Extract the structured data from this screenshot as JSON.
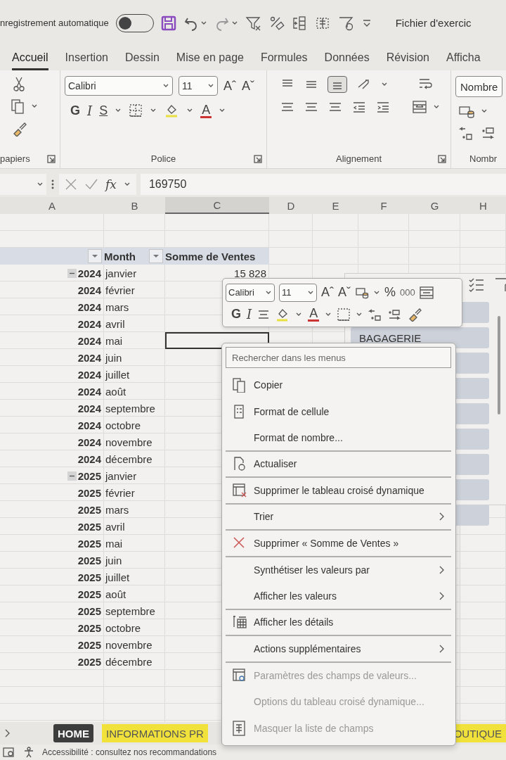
{
  "title_bar": {
    "autosave_label": "nregistrement automatique",
    "autosave_on": false,
    "file_name": "Fichier d'exercic"
  },
  "ribbon_tabs": [
    {
      "label": "Accueil",
      "selected": true
    },
    {
      "label": "Insertion",
      "selected": false
    },
    {
      "label": "Dessin",
      "selected": false
    },
    {
      "label": "Mise en page",
      "selected": false
    },
    {
      "label": "Formules",
      "selected": false
    },
    {
      "label": "Données",
      "selected": false
    },
    {
      "label": "Révision",
      "selected": false
    },
    {
      "label": "Afficha",
      "selected": false
    }
  ],
  "ribbon": {
    "clipboard_label": "papiers",
    "font_name": "Calibri",
    "font_size": "11",
    "grow_glyph": "Aˆ",
    "shrink_glyph": "Aˇ",
    "bold_glyph": "G",
    "italic_glyph": "I",
    "underline_glyph": "S",
    "font_color_glyph": "A",
    "font_label": "Police",
    "alignment_label": "Alignement",
    "number_format": "Nombre",
    "number_label": "Nombr",
    "align_bottom_selected": true
  },
  "formula_bar": {
    "fx": "fx",
    "value": "169750"
  },
  "columns": [
    {
      "label": "A",
      "selected": false
    },
    {
      "label": "B",
      "selected": false
    },
    {
      "label": "C",
      "selected": true
    },
    {
      "label": "D",
      "selected": false
    },
    {
      "label": "E",
      "selected": false
    },
    {
      "label": "F",
      "selected": false
    },
    {
      "label": "G",
      "selected": false
    },
    {
      "label": "H",
      "selected": false
    }
  ],
  "pivot": {
    "month_header": "Month",
    "value_header": "Somme de Ventes",
    "groups": [
      {
        "expanded": true,
        "rows": [
          {
            "year": "2024",
            "month": "janvier",
            "value": "15 828",
            "selected": false
          },
          {
            "year": "2024",
            "month": "février",
            "selected": false
          },
          {
            "year": "2024",
            "month": "mars",
            "selected": false
          },
          {
            "year": "2024",
            "month": "avril",
            "selected": false
          },
          {
            "year": "2024",
            "month": "mai",
            "selected": true
          },
          {
            "year": "2024",
            "month": "juin",
            "selected": false
          },
          {
            "year": "2024",
            "month": "juillet",
            "selected": false
          },
          {
            "year": "2024",
            "month": "août",
            "selected": false
          },
          {
            "year": "2024",
            "month": "septembre",
            "selected": false
          },
          {
            "year": "2024",
            "month": "octobre",
            "selected": false
          },
          {
            "year": "2024",
            "month": "novembre",
            "selected": false
          },
          {
            "year": "2024",
            "month": "décembre",
            "selected": false
          }
        ]
      },
      {
        "expanded": true,
        "rows": [
          {
            "year": "2025",
            "month": "janvier",
            "selected": false
          },
          {
            "year": "2025",
            "month": "février",
            "selected": false
          },
          {
            "year": "2025",
            "month": "mars",
            "selected": false
          },
          {
            "year": "2025",
            "month": "avril",
            "selected": false
          },
          {
            "year": "2025",
            "month": "mai",
            "selected": false
          },
          {
            "year": "2025",
            "month": "juin",
            "selected": false
          },
          {
            "year": "2025",
            "month": "juillet",
            "selected": false
          },
          {
            "year": "2025",
            "month": "août",
            "selected": false
          },
          {
            "year": "2025",
            "month": "septembre",
            "selected": false
          },
          {
            "year": "2025",
            "month": "octobre",
            "selected": false
          },
          {
            "year": "2025",
            "month": "novembre",
            "selected": false
          },
          {
            "year": "2025",
            "month": "décembre",
            "selected": false
          }
        ]
      }
    ]
  },
  "slicer": {
    "buttons": [
      {
        "label": "BAGAGERIE"
      }
    ]
  },
  "mini_toolbar": {
    "font_name": "Calibri",
    "font_size": "11",
    "grow_glyph": "Aˆ",
    "shrink_glyph": "Aˇ",
    "percent": "%",
    "thousands": "000",
    "bold_glyph": "G",
    "italic_glyph": "I",
    "font_color_glyph": "A"
  },
  "context_menu": {
    "search_placeholder": "Rechercher dans les menus",
    "items": [
      {
        "label": "Copier",
        "kind": "copy",
        "submenu": false,
        "disabled": false,
        "divider_below": false
      },
      {
        "label": "Format de cellule",
        "kind": "format",
        "submenu": false,
        "disabled": false,
        "divider_below": false
      },
      {
        "label": "Format de nombre...",
        "kind": "plain",
        "submenu": false,
        "disabled": false,
        "divider_below": true
      },
      {
        "label": "Actualiser",
        "kind": "refresh",
        "submenu": false,
        "disabled": false,
        "divider_below": true
      },
      {
        "label": "Supprimer le tableau croisé dynamique",
        "kind": "remove",
        "submenu": false,
        "disabled": false,
        "divider_below": true
      },
      {
        "label": "Trier",
        "kind": "plain",
        "submenu": true,
        "disabled": false,
        "divider_below": true
      },
      {
        "label": "Supprimer « Somme de Ventes »",
        "kind": "delete",
        "submenu": false,
        "disabled": false,
        "divider_below": true
      },
      {
        "label": "Synthétiser les valeurs par",
        "kind": "plain",
        "submenu": true,
        "disabled": false,
        "divider_below": false
      },
      {
        "label": "Afficher les valeurs",
        "kind": "plain",
        "submenu": true,
        "disabled": false,
        "divider_below": true
      },
      {
        "label": "Afficher les détails",
        "kind": "details",
        "submenu": false,
        "disabled": false,
        "divider_below": true
      },
      {
        "label": "Actions supplémentaires",
        "kind": "plain",
        "submenu": true,
        "disabled": false,
        "divider_below": true
      },
      {
        "label": "Paramètres des champs de valeurs...",
        "kind": "settings",
        "submenu": false,
        "disabled": true,
        "divider_below": false
      },
      {
        "label": "Options du tableau croisé dynamique...",
        "kind": "plain",
        "submenu": false,
        "disabled": true,
        "divider_below": false
      },
      {
        "label": "Masquer la liste de champs",
        "kind": "fields",
        "submenu": false,
        "disabled": true,
        "divider_below": false
      }
    ]
  },
  "sheet_tabs": [
    {
      "label": "HOME",
      "selected": true
    },
    {
      "label": "INFORMATIONS PR",
      "selected": false
    },
    {
      "label": "OUTIQUE",
      "selected": false
    }
  ],
  "status_bar": {
    "accessibility": "Accessibilité : consultez nos recommandations"
  }
}
